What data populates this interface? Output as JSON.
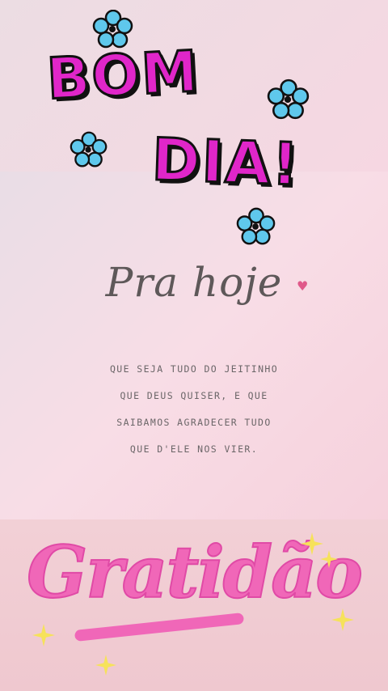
{
  "greeting": {
    "line1": "BOM",
    "line2": "DIA!"
  },
  "subtitle": "Pra hoje",
  "message_lines": [
    "QUE SEJA TUDO DO JEITINHO",
    "QUE DEUS QUISER, E QUE",
    "SAIBAMOS AGRADECER TUDO",
    "QUE D'ELE NOS VIER."
  ],
  "closing_word": "Gratidão",
  "colors": {
    "greeting_magenta": "#e026c9",
    "flower_blue": "#5fc8ec",
    "gratitude_pink": "#f067b8",
    "sparkle_yellow": "#f6e25a",
    "heart_pink": "#e0598a"
  },
  "icons": [
    "flower-icon",
    "heart-icon",
    "sparkle-icon"
  ]
}
